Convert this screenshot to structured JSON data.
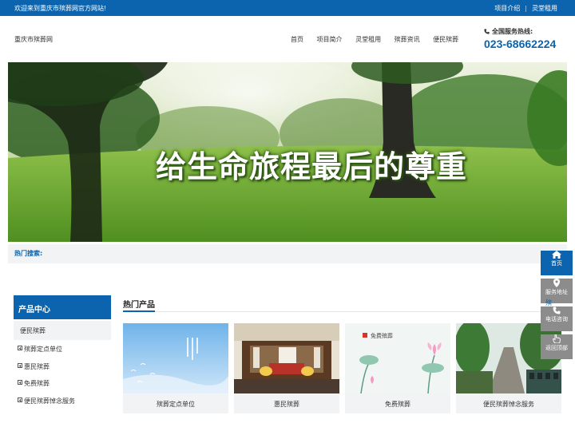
{
  "topbar": {
    "welcome": "欢迎来到重庆市殡葬网官方网站!",
    "links": [
      "项目介绍",
      "灵堂租用"
    ]
  },
  "header": {
    "logo_text": "重庆市殡葬网",
    "nav": [
      "首页",
      "项目简介",
      "灵堂租用",
      "殡葬资讯",
      "便民殡葬"
    ],
    "hotline_label": "全国服务热线:",
    "hotline_number": "023-68662224"
  },
  "banner": {
    "caption": "给生命旅程最后的尊重"
  },
  "hot_search": {
    "label": "热门搜索:"
  },
  "sidebar": {
    "title": "产品中心",
    "first_item": "便民殡葬",
    "items": [
      "殡葬定点单位",
      "惠民殡葬",
      "免费殡葬",
      "便民殡葬悼念服务"
    ]
  },
  "products": {
    "title": "热门产品",
    "cards": [
      {
        "caption": "殡葬定点单位"
      },
      {
        "caption": "惠民殡葬"
      },
      {
        "caption": "免费殡葬"
      },
      {
        "caption": "便民殡葬悼念服务"
      }
    ]
  },
  "float_bar": {
    "buttons": [
      "首页",
      "服务地址",
      "电话咨询",
      "返回顶部"
    ],
    "fragment": "殡"
  },
  "colors": {
    "brand_blue": "#0b64ad",
    "panel_gray": "#f2f3f5",
    "float_gray": "#8c8c8c"
  }
}
